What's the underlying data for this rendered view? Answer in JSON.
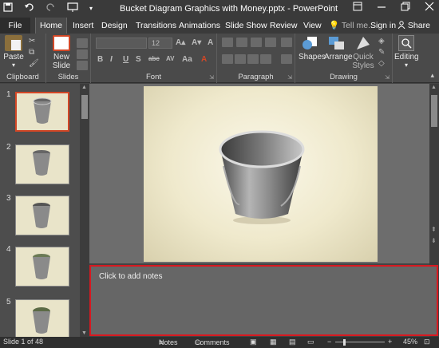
{
  "window": {
    "title": "Bucket Diagram Graphics with Money.pptx - PowerPoint"
  },
  "qat": {
    "save": "save-icon",
    "undo": "undo-icon",
    "redo": "redo-icon",
    "slideshow": "slideshow-icon"
  },
  "tabs": [
    "File",
    "Home",
    "Insert",
    "Design",
    "Transitions",
    "Animations",
    "Slide Show",
    "Review",
    "View"
  ],
  "tell_me": "Tell me...",
  "sign_in": "Sign in",
  "share": "Share",
  "ribbon": {
    "clipboard": {
      "paste": "Paste",
      "label": "Clipboard"
    },
    "slides": {
      "new_slide": "New Slide",
      "label": "Slides"
    },
    "font": {
      "size": "12",
      "label": "Font",
      "buttons": [
        "B",
        "I",
        "U",
        "S",
        "abc",
        "AV",
        "Aa",
        "A"
      ]
    },
    "paragraph": {
      "label": "Paragraph"
    },
    "drawing": {
      "shapes": "Shapes",
      "arrange": "Arrange",
      "quick_styles": "Quick Styles",
      "label": "Drawing"
    },
    "editing": {
      "label": "Editing"
    }
  },
  "thumbnails": [
    {
      "number": "1"
    },
    {
      "number": "2"
    },
    {
      "number": "3"
    },
    {
      "number": "4"
    },
    {
      "number": "5"
    }
  ],
  "notes": {
    "placeholder": "Click to add notes"
  },
  "status": {
    "slide_info": "Slide 1 of 48",
    "notes": "Notes",
    "comments": "Comments",
    "zoom": "45%"
  },
  "colors": {
    "accent": "#d24726",
    "highlight": "#d71920",
    "ribbon": "#4a4a4a"
  }
}
